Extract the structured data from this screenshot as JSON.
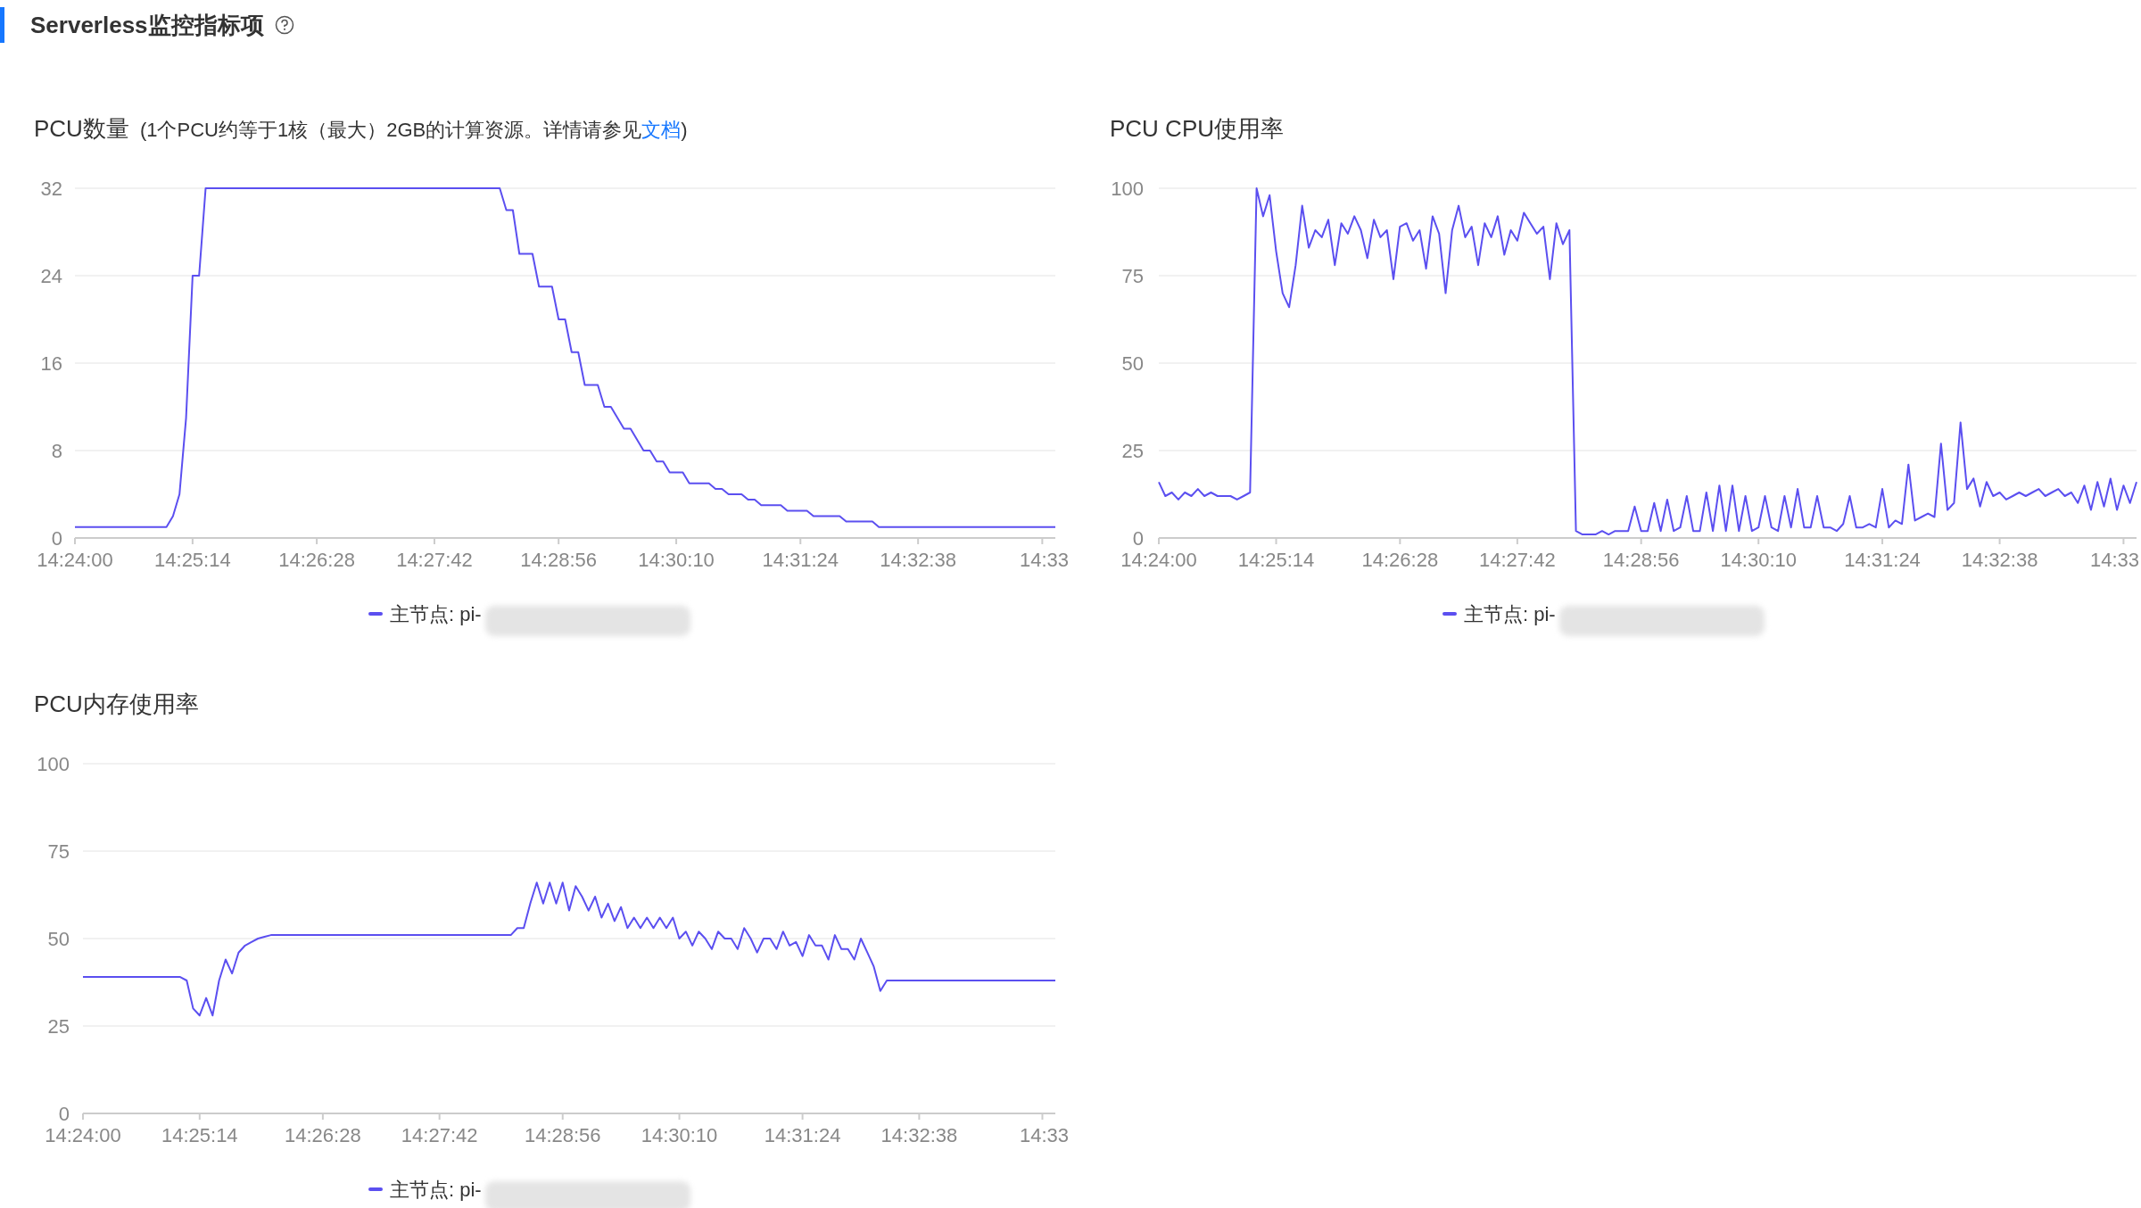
{
  "section_title": "Serverless监控指标项",
  "charts": [
    {
      "title": "PCU数量",
      "note": {
        "before": "(1个PCU约等于1核（最大）2GB的计算资源。详情请参见",
        "link": "文档",
        "after": ")"
      },
      "chart_data": {
        "type": "line",
        "grid": true,
        "ylim": [
          0,
          32
        ],
        "yticks": [
          0,
          8,
          16,
          24,
          32
        ],
        "categories": [
          "14:24:00",
          null,
          null,
          null,
          null,
          null,
          null,
          null,
          null,
          null,
          null,
          null,
          null,
          null,
          null,
          null,
          null,
          null,
          "14:25:14",
          null,
          null,
          null,
          null,
          null,
          null,
          null,
          null,
          null,
          null,
          null,
          null,
          null,
          null,
          null,
          null,
          null,
          null,
          "14:26:28",
          null,
          null,
          null,
          null,
          null,
          null,
          null,
          null,
          null,
          null,
          null,
          null,
          null,
          null,
          null,
          null,
          null,
          "14:27:42",
          null,
          null,
          null,
          null,
          null,
          null,
          null,
          null,
          null,
          null,
          null,
          null,
          null,
          null,
          null,
          null,
          null,
          null,
          "14:28:56",
          null,
          null,
          null,
          null,
          null,
          null,
          null,
          null,
          null,
          null,
          null,
          null,
          null,
          null,
          null,
          null,
          null,
          "14:30:10",
          null,
          null,
          null,
          null,
          null,
          null,
          null,
          null,
          null,
          null,
          null,
          null,
          null,
          null,
          null,
          null,
          null,
          null,
          "14:31:24",
          null,
          null,
          null,
          null,
          null,
          null,
          null,
          null,
          null,
          null,
          null,
          null,
          null,
          null,
          null,
          null,
          null,
          "14:32:38",
          null,
          null,
          null,
          null,
          null,
          null,
          null,
          null,
          null,
          null,
          null,
          null,
          null,
          null,
          null,
          null,
          null,
          null,
          "14:33",
          null,
          null
        ],
        "series": [
          {
            "name": "主节点: pi-",
            "color": "#5b4ff0",
            "values": [
              1,
              1,
              1,
              1,
              1,
              1,
              1,
              1,
              1,
              1,
              1,
              1,
              1,
              1,
              1,
              2,
              4,
              11,
              24,
              24,
              32,
              32,
              32,
              32,
              32,
              32,
              32,
              32,
              32,
              32,
              32,
              32,
              32,
              32,
              32,
              32,
              32,
              32,
              32,
              32,
              32,
              32,
              32,
              32,
              32,
              32,
              32,
              32,
              32,
              32,
              32,
              32,
              32,
              32,
              32,
              32,
              32,
              32,
              32,
              32,
              32,
              32,
              32,
              32,
              32,
              32,
              30,
              30,
              26,
              26,
              26,
              23,
              23,
              23,
              20,
              20,
              17,
              17,
              14,
              14,
              14,
              12,
              12,
              11,
              10,
              10,
              9,
              8,
              8,
              7,
              7,
              6,
              6,
              6,
              5,
              5,
              5,
              5,
              4.5,
              4.5,
              4,
              4,
              4,
              3.5,
              3.5,
              3,
              3,
              3,
              3,
              2.5,
              2.5,
              2.5,
              2.5,
              2,
              2,
              2,
              2,
              2,
              1.5,
              1.5,
              1.5,
              1.5,
              1.5,
              1,
              1,
              1,
              1,
              1,
              1,
              1,
              1,
              1,
              1,
              1,
              1,
              1,
              1,
              1,
              1,
              1,
              1,
              1,
              1,
              1,
              1,
              1,
              1,
              1,
              1,
              1,
              1
            ]
          }
        ]
      }
    },
    {
      "title": "PCU CPU使用率",
      "chart_data": {
        "type": "line",
        "grid": true,
        "ylim": [
          0,
          100
        ],
        "yticks": [
          0,
          25,
          50,
          75,
          100
        ],
        "categories": [
          "14:24:00",
          null,
          null,
          null,
          null,
          null,
          null,
          null,
          null,
          null,
          null,
          null,
          null,
          null,
          null,
          null,
          null,
          null,
          "14:25:14",
          null,
          null,
          null,
          null,
          null,
          null,
          null,
          null,
          null,
          null,
          null,
          null,
          null,
          null,
          null,
          null,
          null,
          null,
          "14:26:28",
          null,
          null,
          null,
          null,
          null,
          null,
          null,
          null,
          null,
          null,
          null,
          null,
          null,
          null,
          null,
          null,
          null,
          "14:27:42",
          null,
          null,
          null,
          null,
          null,
          null,
          null,
          null,
          null,
          null,
          null,
          null,
          null,
          null,
          null,
          null,
          null,
          null,
          "14:28:56",
          null,
          null,
          null,
          null,
          null,
          null,
          null,
          null,
          null,
          null,
          null,
          null,
          null,
          null,
          null,
          null,
          null,
          "14:30:10",
          null,
          null,
          null,
          null,
          null,
          null,
          null,
          null,
          null,
          null,
          null,
          null,
          null,
          null,
          null,
          null,
          null,
          null,
          "14:31:24",
          null,
          null,
          null,
          null,
          null,
          null,
          null,
          null,
          null,
          null,
          null,
          null,
          null,
          null,
          null,
          null,
          null,
          "14:32:38",
          null,
          null,
          null,
          null,
          null,
          null,
          null,
          null,
          null,
          null,
          null,
          null,
          null,
          null,
          null,
          null,
          null,
          null,
          "14:33",
          null,
          null
        ],
        "series": [
          {
            "name": "主节点: pi-",
            "color": "#5b4ff0",
            "values": [
              16,
              12,
              13,
              11,
              13,
              12,
              14,
              12,
              13,
              12,
              12,
              12,
              11,
              12,
              13,
              100,
              92,
              98,
              82,
              70,
              66,
              78,
              95,
              83,
              88,
              86,
              91,
              78,
              90,
              87,
              92,
              88,
              80,
              91,
              86,
              88,
              74,
              89,
              90,
              85,
              88,
              77,
              92,
              87,
              70,
              88,
              95,
              86,
              89,
              78,
              90,
              86,
              92,
              81,
              88,
              85,
              93,
              90,
              87,
              89,
              74,
              90,
              84,
              88,
              2,
              1,
              1,
              1,
              2,
              1,
              2,
              2,
              2,
              9,
              2,
              2,
              10,
              2,
              11,
              2,
              3,
              12,
              2,
              2,
              13,
              2,
              15,
              2,
              15,
              2,
              12,
              2,
              3,
              12,
              3,
              2,
              12,
              3,
              14,
              3,
              3,
              12,
              3,
              3,
              2,
              4,
              12,
              3,
              3,
              4,
              3,
              14,
              3,
              5,
              4,
              21,
              5,
              6,
              7,
              6,
              27,
              8,
              10,
              33,
              14,
              17,
              9,
              16,
              12,
              13,
              11,
              12,
              13,
              12,
              13,
              14,
              12,
              13,
              14,
              12,
              13,
              10,
              15,
              8,
              16,
              9,
              17,
              8,
              15,
              10,
              16
            ]
          }
        ]
      }
    },
    {
      "title": "PCU内存使用率",
      "chart_data": {
        "type": "line",
        "grid": true,
        "ylim": [
          0,
          100
        ],
        "yticks": [
          0,
          25,
          50,
          75,
          100
        ],
        "categories": [
          "14:24:00",
          null,
          null,
          null,
          null,
          null,
          null,
          null,
          null,
          null,
          null,
          null,
          null,
          null,
          null,
          null,
          null,
          null,
          "14:25:14",
          null,
          null,
          null,
          null,
          null,
          null,
          null,
          null,
          null,
          null,
          null,
          null,
          null,
          null,
          null,
          null,
          null,
          null,
          "14:26:28",
          null,
          null,
          null,
          null,
          null,
          null,
          null,
          null,
          null,
          null,
          null,
          null,
          null,
          null,
          null,
          null,
          null,
          "14:27:42",
          null,
          null,
          null,
          null,
          null,
          null,
          null,
          null,
          null,
          null,
          null,
          null,
          null,
          null,
          null,
          null,
          null,
          null,
          "14:28:56",
          null,
          null,
          null,
          null,
          null,
          null,
          null,
          null,
          null,
          null,
          null,
          null,
          null,
          null,
          null,
          null,
          null,
          "14:30:10",
          null,
          null,
          null,
          null,
          null,
          null,
          null,
          null,
          null,
          null,
          null,
          null,
          null,
          null,
          null,
          null,
          null,
          null,
          "14:31:24",
          null,
          null,
          null,
          null,
          null,
          null,
          null,
          null,
          null,
          null,
          null,
          null,
          null,
          null,
          null,
          null,
          null,
          "14:32:38",
          null,
          null,
          null,
          null,
          null,
          null,
          null,
          null,
          null,
          null,
          null,
          null,
          null,
          null,
          null,
          null,
          null,
          null,
          "14:33",
          null,
          null
        ],
        "series": [
          {
            "name": "主节点: pi-",
            "color": "#5b4ff0",
            "values": [
              39,
              39,
              39,
              39,
              39,
              39,
              39,
              39,
              39,
              39,
              39,
              39,
              39,
              39,
              39,
              39,
              38,
              30,
              28,
              33,
              28,
              38,
              44,
              40,
              46,
              48,
              49,
              50,
              50.5,
              51,
              51,
              51,
              51,
              51,
              51,
              51,
              51,
              51,
              51,
              51,
              51,
              51,
              51,
              51,
              51,
              51,
              51,
              51,
              51,
              51,
              51,
              51,
              51,
              51,
              51,
              51,
              51,
              51,
              51,
              51,
              51,
              51,
              51,
              51,
              51,
              51,
              51,
              53,
              53,
              60,
              66,
              60,
              66,
              60,
              66,
              58,
              65,
              62,
              58,
              62,
              56,
              60,
              55,
              59,
              53,
              56,
              53,
              56,
              53,
              56,
              53,
              56,
              50,
              52,
              48,
              52,
              50,
              47,
              52,
              50,
              50,
              47,
              53,
              50,
              46,
              50,
              50,
              47,
              52,
              48,
              49,
              45,
              51,
              48,
              48,
              44,
              51,
              47,
              47,
              44,
              50,
              46,
              42,
              35,
              38,
              38,
              38,
              38,
              38,
              38,
              38,
              38,
              38,
              38,
              38,
              38,
              38,
              38,
              38,
              38,
              38,
              38,
              38,
              38,
              38,
              38,
              38,
              38,
              38,
              38,
              38
            ]
          }
        ]
      }
    }
  ]
}
